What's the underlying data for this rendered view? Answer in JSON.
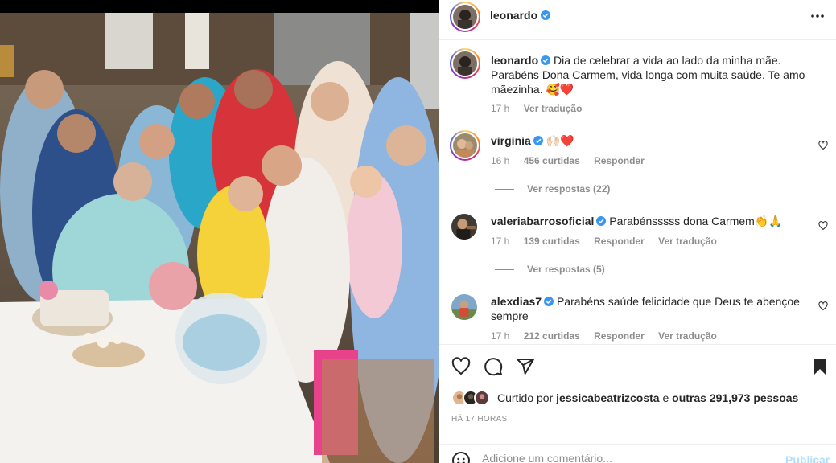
{
  "post": {
    "author": "leonardo",
    "more_icon": "more-horizontal-icon",
    "caption_user": "leonardo",
    "caption_lines": [
      "Dia de celebrar a vida ao lado da minha mãe.",
      "Parabéns Dona Carmem, vida longa com muita saúde. Te amo",
      "mãezinha. 🥰❤️"
    ],
    "caption_time": "17 h",
    "caption_translate": "Ver tradução"
  },
  "comments": [
    {
      "user": "virginia",
      "text": "🙌🏻❤️",
      "time": "16 h",
      "likes": "456 curtidas",
      "reply": "Responder",
      "translate": "",
      "view_replies": "Ver respostas (22)"
    },
    {
      "user": "valeriabarrosoficial",
      "text": "Parabénsssss dona Carmem👏🙏",
      "time": "17 h",
      "likes": "139 curtidas",
      "reply": "Responder",
      "translate": "Ver tradução",
      "view_replies": "Ver respostas (5)"
    },
    {
      "user": "alexdias7",
      "text_lines": [
        "Parabéns saúde felicidade que Deus te abençoe",
        "sempre"
      ],
      "time": "17 h",
      "likes": "212 curtidas",
      "reply": "Responder",
      "translate": "Ver tradução"
    }
  ],
  "likes": {
    "prefix": "Curtido por ",
    "user": "jessicabeatrizcosta",
    "middle": " e ",
    "others": "outras 291,973 pessoas"
  },
  "timestamp": "HÁ 17 HORAS",
  "add_comment": {
    "placeholder": "Adicione um comentário...",
    "publish": "Publicar"
  },
  "colors": {
    "verified": "#3897f0",
    "publish_disabled": "#b2dffc",
    "muted": "#8e8e8e"
  }
}
